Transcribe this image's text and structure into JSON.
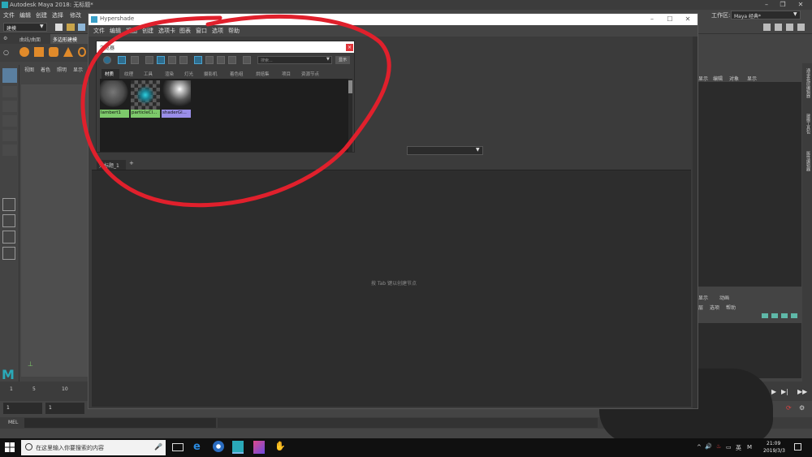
{
  "maya": {
    "title": "Autodesk Maya 2018: 无标题*",
    "menus": [
      "文件",
      "编辑",
      "创建",
      "选择",
      "修改"
    ],
    "workspace_label": "工作区:",
    "workspace_value": "Maya 经典*",
    "mode_dropdown": "建模",
    "shelf_tabs": [
      "曲线/曲面",
      "多边形建模"
    ],
    "viewport_menus": [
      "视图",
      "着色",
      "照明",
      "显示"
    ],
    "right_panel_menus": [
      "显示",
      "编辑",
      "对象",
      "显示"
    ],
    "right_panel2_tabs": [
      "显示",
      "动画"
    ],
    "right_panel2_menus": [
      "层",
      "选项",
      "帮助"
    ],
    "right_edge_tabs": [
      "通道盒/层编辑器",
      "建模工具包",
      "属性编辑器"
    ],
    "timeline_ticks": [
      "1",
      "5",
      "10"
    ],
    "range_start": "1",
    "range_current": "1",
    "mel_label": "MEL"
  },
  "hypershade": {
    "title": "Hypershade",
    "menus": [
      "文件",
      "编辑",
      "视图",
      "创建",
      "选项卡",
      "图表",
      "窗口",
      "选项",
      "帮助"
    ],
    "work_tab": "无标题_1",
    "add_tab": "+",
    "hint": "按 Tab 键以创建节点"
  },
  "browser": {
    "title": "浏览器",
    "search_placeholder": "搜索...",
    "show_button": "显示",
    "tabs": [
      "材质",
      "纹理",
      "工具",
      "渲染",
      "灯光",
      "摄影机",
      "着色组",
      "烘焙集",
      "项目",
      "资源节点"
    ],
    "swatches": [
      {
        "label": "lambert1",
        "label_color": "#7dc96b",
        "kind": "lambert"
      },
      {
        "label": "particleCl...",
        "label_color": "#7dc96b",
        "kind": "particle"
      },
      {
        "label": "shaderGl...",
        "label_color": "#9a8ee8",
        "kind": "glow"
      }
    ]
  },
  "taskbar": {
    "search_placeholder": "在这里输入你要搜索的内容",
    "time": "21:09",
    "date": "2019/3/3",
    "ime": "英",
    "tray": "M"
  },
  "colors": {
    "annotation": "#e0202c",
    "accent": "#3aa0c8"
  }
}
